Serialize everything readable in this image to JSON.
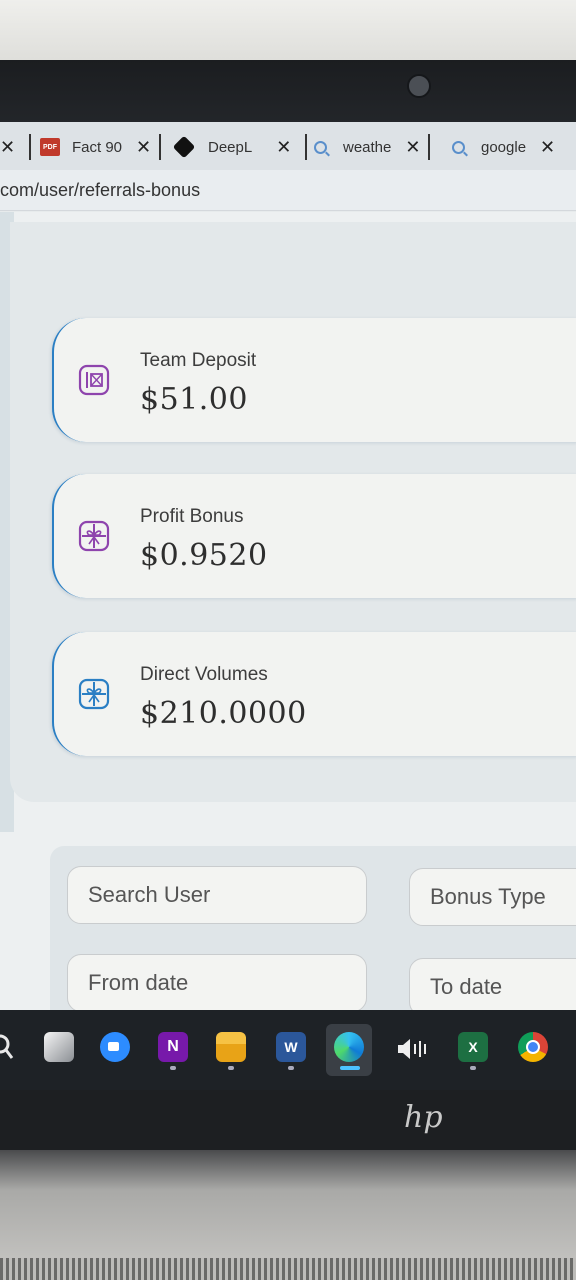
{
  "browser": {
    "tabs": [
      {
        "label": "Fact 90",
        "icon": "pdf-icon",
        "icon_text": "PDF"
      },
      {
        "label": "DeepL",
        "icon": "deepl-icon"
      },
      {
        "label": "weathe",
        "icon": "search-icon"
      },
      {
        "label": "google",
        "icon": "search-icon"
      }
    ],
    "close_glyph": "✕",
    "url": "com/user/referrals-bonus"
  },
  "stats": [
    {
      "label": "Team Deposit",
      "value": "$51.00",
      "icon": "vault-icon",
      "color": "#8e44ad"
    },
    {
      "label": "Profit Bonus",
      "value": "$0.9520",
      "icon": "gift-icon",
      "color": "#8e44ad"
    },
    {
      "label": "Direct Volumes",
      "value": "$210.0000",
      "icon": "gift-icon",
      "color": "#2b7fc4"
    }
  ],
  "filters": {
    "search_user": "Search User",
    "bonus_type": "Bonus Type",
    "from_date": "From date",
    "to_date": "To date"
  },
  "taskbar": {
    "apps": [
      "search-icon",
      "task-view-icon",
      "zoom-icon",
      "onenote-icon",
      "file-explorer-icon",
      "word-icon",
      "edge-icon",
      "volume-icon",
      "excel-icon",
      "chrome-icon"
    ],
    "onenote_letter": "N",
    "word_letter": "W",
    "excel_letter": "X"
  },
  "laptop_logo": "hp"
}
